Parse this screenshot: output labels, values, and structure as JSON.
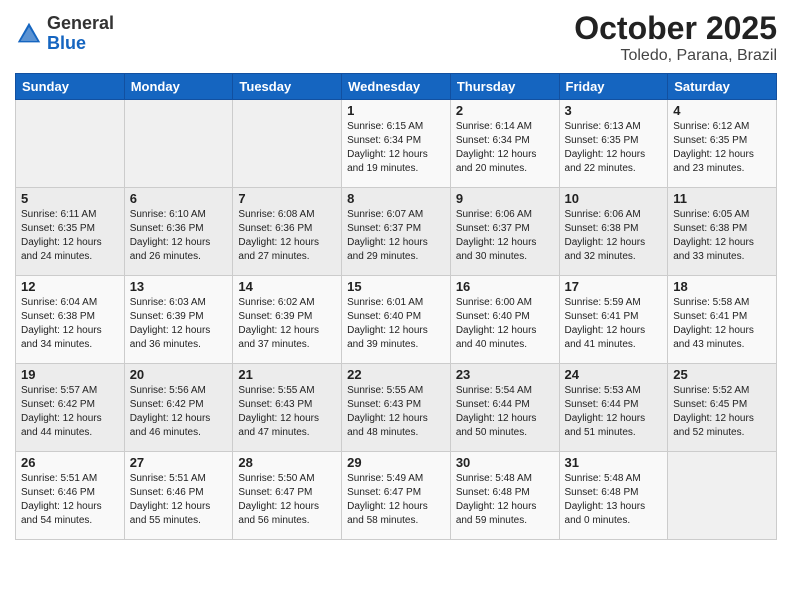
{
  "header": {
    "logo_general": "General",
    "logo_blue": "Blue",
    "title": "October 2025",
    "subtitle": "Toledo, Parana, Brazil"
  },
  "calendar": {
    "days_of_week": [
      "Sunday",
      "Monday",
      "Tuesday",
      "Wednesday",
      "Thursday",
      "Friday",
      "Saturday"
    ],
    "weeks": [
      [
        {
          "day": "",
          "info": ""
        },
        {
          "day": "",
          "info": ""
        },
        {
          "day": "",
          "info": ""
        },
        {
          "day": "1",
          "info": "Sunrise: 6:15 AM\nSunset: 6:34 PM\nDaylight: 12 hours\nand 19 minutes."
        },
        {
          "day": "2",
          "info": "Sunrise: 6:14 AM\nSunset: 6:34 PM\nDaylight: 12 hours\nand 20 minutes."
        },
        {
          "day": "3",
          "info": "Sunrise: 6:13 AM\nSunset: 6:35 PM\nDaylight: 12 hours\nand 22 minutes."
        },
        {
          "day": "4",
          "info": "Sunrise: 6:12 AM\nSunset: 6:35 PM\nDaylight: 12 hours\nand 23 minutes."
        }
      ],
      [
        {
          "day": "5",
          "info": "Sunrise: 6:11 AM\nSunset: 6:35 PM\nDaylight: 12 hours\nand 24 minutes."
        },
        {
          "day": "6",
          "info": "Sunrise: 6:10 AM\nSunset: 6:36 PM\nDaylight: 12 hours\nand 26 minutes."
        },
        {
          "day": "7",
          "info": "Sunrise: 6:08 AM\nSunset: 6:36 PM\nDaylight: 12 hours\nand 27 minutes."
        },
        {
          "day": "8",
          "info": "Sunrise: 6:07 AM\nSunset: 6:37 PM\nDaylight: 12 hours\nand 29 minutes."
        },
        {
          "day": "9",
          "info": "Sunrise: 6:06 AM\nSunset: 6:37 PM\nDaylight: 12 hours\nand 30 minutes."
        },
        {
          "day": "10",
          "info": "Sunrise: 6:06 AM\nSunset: 6:38 PM\nDaylight: 12 hours\nand 32 minutes."
        },
        {
          "day": "11",
          "info": "Sunrise: 6:05 AM\nSunset: 6:38 PM\nDaylight: 12 hours\nand 33 minutes."
        }
      ],
      [
        {
          "day": "12",
          "info": "Sunrise: 6:04 AM\nSunset: 6:38 PM\nDaylight: 12 hours\nand 34 minutes."
        },
        {
          "day": "13",
          "info": "Sunrise: 6:03 AM\nSunset: 6:39 PM\nDaylight: 12 hours\nand 36 minutes."
        },
        {
          "day": "14",
          "info": "Sunrise: 6:02 AM\nSunset: 6:39 PM\nDaylight: 12 hours\nand 37 minutes."
        },
        {
          "day": "15",
          "info": "Sunrise: 6:01 AM\nSunset: 6:40 PM\nDaylight: 12 hours\nand 39 minutes."
        },
        {
          "day": "16",
          "info": "Sunrise: 6:00 AM\nSunset: 6:40 PM\nDaylight: 12 hours\nand 40 minutes."
        },
        {
          "day": "17",
          "info": "Sunrise: 5:59 AM\nSunset: 6:41 PM\nDaylight: 12 hours\nand 41 minutes."
        },
        {
          "day": "18",
          "info": "Sunrise: 5:58 AM\nSunset: 6:41 PM\nDaylight: 12 hours\nand 43 minutes."
        }
      ],
      [
        {
          "day": "19",
          "info": "Sunrise: 5:57 AM\nSunset: 6:42 PM\nDaylight: 12 hours\nand 44 minutes."
        },
        {
          "day": "20",
          "info": "Sunrise: 5:56 AM\nSunset: 6:42 PM\nDaylight: 12 hours\nand 46 minutes."
        },
        {
          "day": "21",
          "info": "Sunrise: 5:55 AM\nSunset: 6:43 PM\nDaylight: 12 hours\nand 47 minutes."
        },
        {
          "day": "22",
          "info": "Sunrise: 5:55 AM\nSunset: 6:43 PM\nDaylight: 12 hours\nand 48 minutes."
        },
        {
          "day": "23",
          "info": "Sunrise: 5:54 AM\nSunset: 6:44 PM\nDaylight: 12 hours\nand 50 minutes."
        },
        {
          "day": "24",
          "info": "Sunrise: 5:53 AM\nSunset: 6:44 PM\nDaylight: 12 hours\nand 51 minutes."
        },
        {
          "day": "25",
          "info": "Sunrise: 5:52 AM\nSunset: 6:45 PM\nDaylight: 12 hours\nand 52 minutes."
        }
      ],
      [
        {
          "day": "26",
          "info": "Sunrise: 5:51 AM\nSunset: 6:46 PM\nDaylight: 12 hours\nand 54 minutes."
        },
        {
          "day": "27",
          "info": "Sunrise: 5:51 AM\nSunset: 6:46 PM\nDaylight: 12 hours\nand 55 minutes."
        },
        {
          "day": "28",
          "info": "Sunrise: 5:50 AM\nSunset: 6:47 PM\nDaylight: 12 hours\nand 56 minutes."
        },
        {
          "day": "29",
          "info": "Sunrise: 5:49 AM\nSunset: 6:47 PM\nDaylight: 12 hours\nand 58 minutes."
        },
        {
          "day": "30",
          "info": "Sunrise: 5:48 AM\nSunset: 6:48 PM\nDaylight: 12 hours\nand 59 minutes."
        },
        {
          "day": "31",
          "info": "Sunrise: 5:48 AM\nSunset: 6:48 PM\nDaylight: 13 hours\nand 0 minutes."
        },
        {
          "day": "",
          "info": ""
        }
      ]
    ]
  }
}
